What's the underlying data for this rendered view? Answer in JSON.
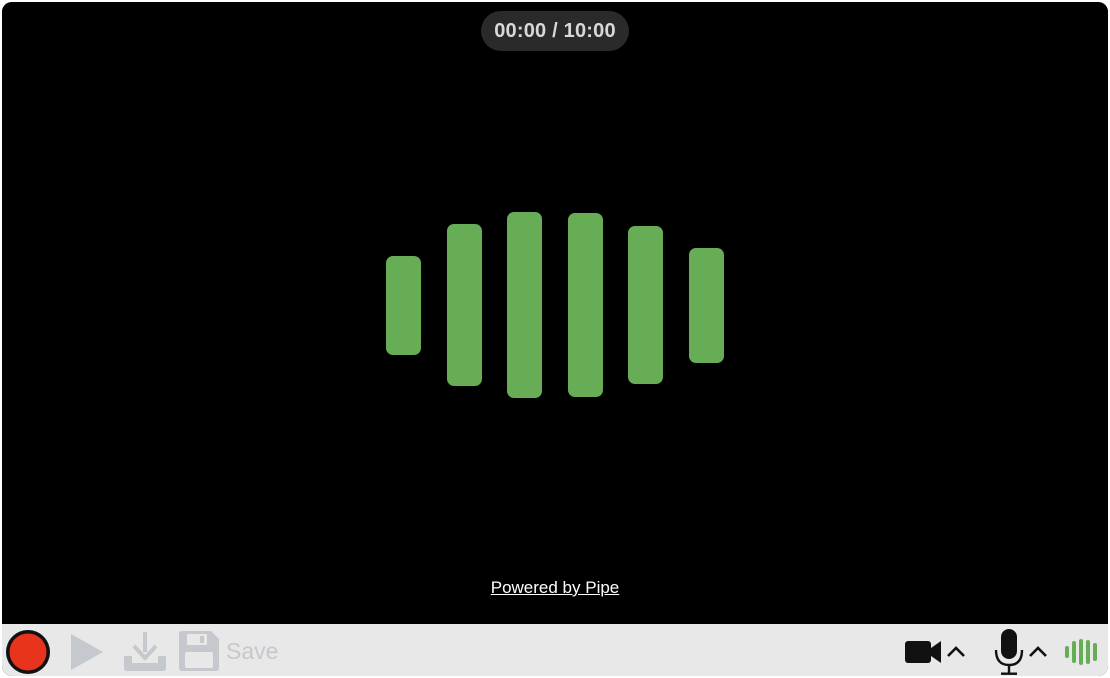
{
  "timer": {
    "elapsed": "00:00",
    "limit": "10:00",
    "display": "00:00 / 10:00"
  },
  "visualizer": {
    "bar_color": "#66ad56",
    "levels": [
      0.53,
      0.87,
      1.0,
      0.99,
      0.85,
      0.62
    ]
  },
  "footer": {
    "powered_by": "Powered by Pipe"
  },
  "toolbar": {
    "record_icon": "record-icon",
    "record_color": "#e8341c",
    "play_icon": "play-icon",
    "download_icon": "download-icon",
    "save_icon": "floppy-disk-icon",
    "save_label": "Save",
    "disabled_color": "#c5c9cd",
    "camera_icon": "video-camera-icon",
    "microphone_icon": "microphone-icon",
    "audio_level_icon": "audio-level-icon",
    "audio_level_color": "#66ad56",
    "dropdown_icon": "chevron-up-icon"
  }
}
